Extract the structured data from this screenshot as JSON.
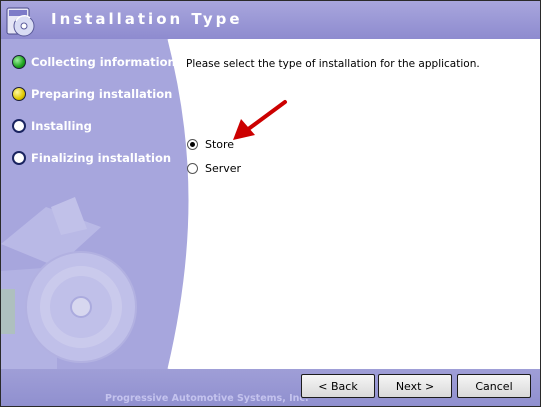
{
  "window": {
    "title": "Installation Type",
    "app_icon": "installer-cd-icon"
  },
  "steps": [
    {
      "label": "Collecting information",
      "status": "complete",
      "color": "#2db52d"
    },
    {
      "label": "Preparing installation",
      "status": "current",
      "color": "#e8d800"
    },
    {
      "label": "Installing",
      "status": "pending"
    },
    {
      "label": "Finalizing installation",
      "status": "pending"
    }
  ],
  "main": {
    "prompt": "Please select the type of installation for the application.",
    "options": [
      {
        "label": "Store",
        "selected": true
      },
      {
        "label": "Server",
        "selected": false
      }
    ]
  },
  "footer": {
    "company": "Progressive Automotive Systems, Inc.",
    "back_label": "< Back",
    "next_label": "Next >",
    "cancel_label": "Cancel"
  },
  "colors": {
    "accent": "#9593d4",
    "arrow": "#cc0000"
  }
}
